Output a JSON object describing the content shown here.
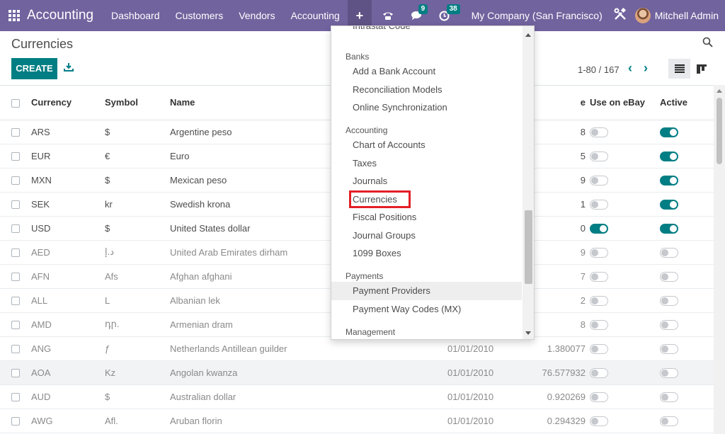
{
  "navbar": {
    "brand": "Accounting",
    "menu": [
      "Dashboard",
      "Customers",
      "Vendors",
      "Accounting"
    ],
    "plus": "+",
    "messages_badge": "9",
    "activities_badge": "38",
    "company": "My Company (San Francisco)",
    "user": "Mitchell Admin",
    "icons": [
      "apps-icon",
      "phone-icon",
      "chat-icon",
      "clock-icon",
      "tools-icon"
    ]
  },
  "control": {
    "title": "Currencies",
    "create_label": "CREATE",
    "pager": "1-80 / 167",
    "search_placeholder": ""
  },
  "table": {
    "headers": [
      "Currency",
      "Symbol",
      "Name",
      "e",
      "Use on eBay",
      "Active"
    ],
    "rows": [
      {
        "code": "ARS",
        "symbol": "$",
        "name": "Argentine peso",
        "date": "",
        "rate": "8",
        "ebay": false,
        "active": true
      },
      {
        "code": "EUR",
        "symbol": "€",
        "name": "Euro",
        "date": "",
        "rate": "5",
        "ebay": false,
        "active": true
      },
      {
        "code": "MXN",
        "symbol": "$",
        "name": "Mexican peso",
        "date": "",
        "rate": "9",
        "ebay": false,
        "active": true
      },
      {
        "code": "SEK",
        "symbol": "kr",
        "name": "Swedish krona",
        "date": "",
        "rate": "1",
        "ebay": false,
        "active": true
      },
      {
        "code": "USD",
        "symbol": "$",
        "name": "United States dollar",
        "date": "",
        "rate": "0",
        "ebay": true,
        "active": true
      },
      {
        "code": "AED",
        "symbol": "د.إ",
        "name": "United Arab Emirates dirham",
        "date": "",
        "rate": "9",
        "ebay": false,
        "active": false
      },
      {
        "code": "AFN",
        "symbol": "Afs",
        "name": "Afghan afghani",
        "date": "",
        "rate": "7",
        "ebay": false,
        "active": false
      },
      {
        "code": "ALL",
        "symbol": "L",
        "name": "Albanian lek",
        "date": "",
        "rate": "2",
        "ebay": false,
        "active": false
      },
      {
        "code": "AMD",
        "symbol": "դր.",
        "name": "Armenian dram",
        "date": "",
        "rate": "8",
        "ebay": false,
        "active": false
      },
      {
        "code": "ANG",
        "symbol": "ƒ",
        "name": "Netherlands Antillean guilder",
        "date": "01/01/2010",
        "rate": "1.380077",
        "ebay": false,
        "active": false
      },
      {
        "code": "AOA",
        "symbol": "Kz",
        "name": "Angolan kwanza",
        "date": "01/01/2010",
        "rate": "76.577932",
        "ebay": false,
        "active": false
      },
      {
        "code": "AUD",
        "symbol": "$",
        "name": "Australian dollar",
        "date": "01/01/2010",
        "rate": "0.920269",
        "ebay": false,
        "active": false
      },
      {
        "code": "AWG",
        "symbol": "Afl.",
        "name": "Aruban florin",
        "date": "01/01/2010",
        "rate": "0.294329",
        "ebay": false,
        "active": false
      }
    ]
  },
  "dropdown": {
    "top_item": "Intrastat Code",
    "sections": [
      {
        "header": "Banks",
        "items": [
          "Add a Bank Account",
          "Reconciliation Models",
          "Online Synchronization"
        ]
      },
      {
        "header": "Accounting",
        "items": [
          "Chart of Accounts",
          "Taxes",
          "Journals",
          "Currencies",
          "Fiscal Positions",
          "Journal Groups",
          "1099 Boxes"
        ]
      },
      {
        "header": "Payments",
        "items": [
          "Payment Providers",
          "Payment Way Codes (MX)"
        ]
      },
      {
        "header": "Management",
        "items": []
      }
    ],
    "highlighted": "Currencies",
    "hovered": "Payment Providers"
  },
  "colors": {
    "navbar": "#71639e",
    "primary": "#017e84",
    "highlight_box": "#e21f26"
  }
}
